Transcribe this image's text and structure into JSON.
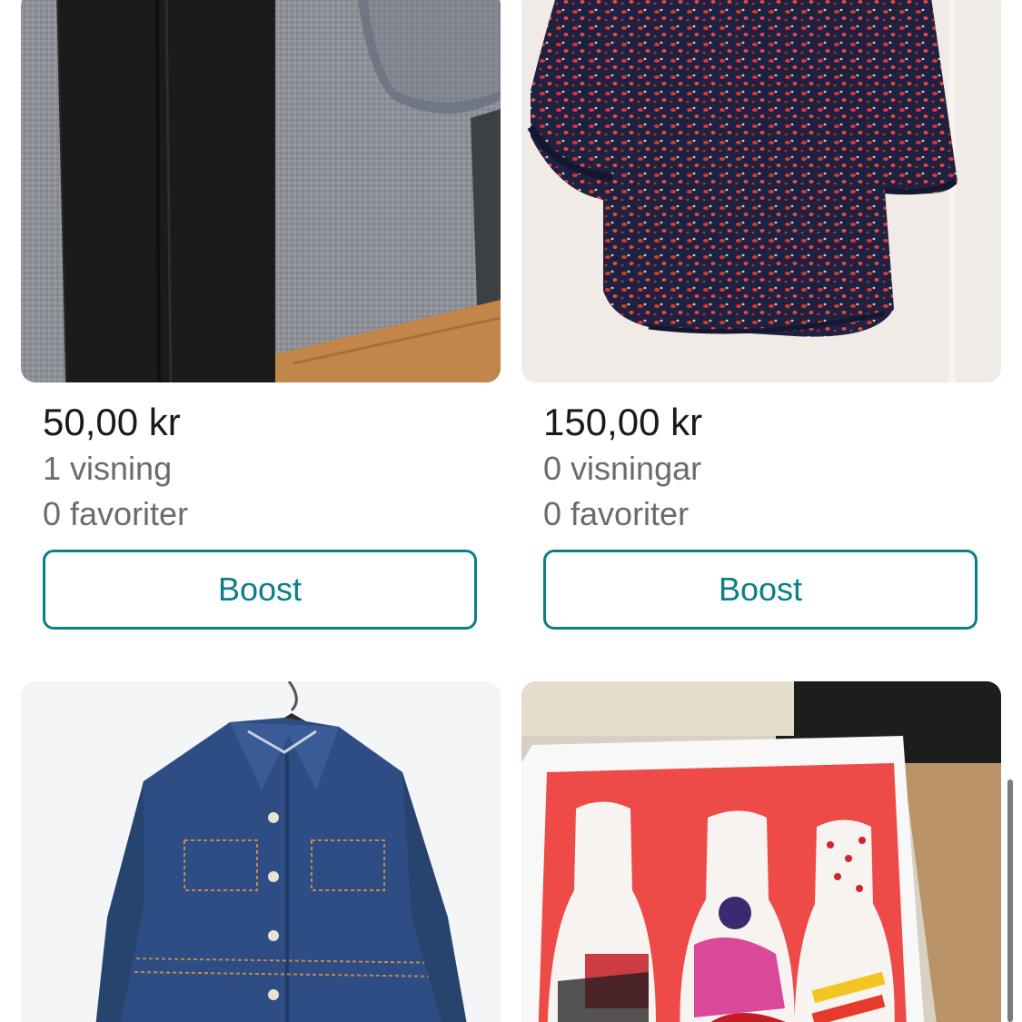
{
  "listings": [
    {
      "price": "50,00 kr",
      "views": "1 visning",
      "favorites": "0 favoriter",
      "boost_label": "Boost",
      "image": "black-trousers-photo"
    },
    {
      "price": "150,00 kr",
      "views": "0 visningar",
      "favorites": "0 favoriter",
      "boost_label": "Boost",
      "image": "red-dotted-blouse-photo"
    },
    {
      "image": "denim-jacket-photo"
    },
    {
      "image": "coca-cola-light-bottles-photo"
    }
  ],
  "colors": {
    "accent": "#0a7f86",
    "price_text": "#1a1a1a",
    "meta_text": "#6b6b6b"
  }
}
